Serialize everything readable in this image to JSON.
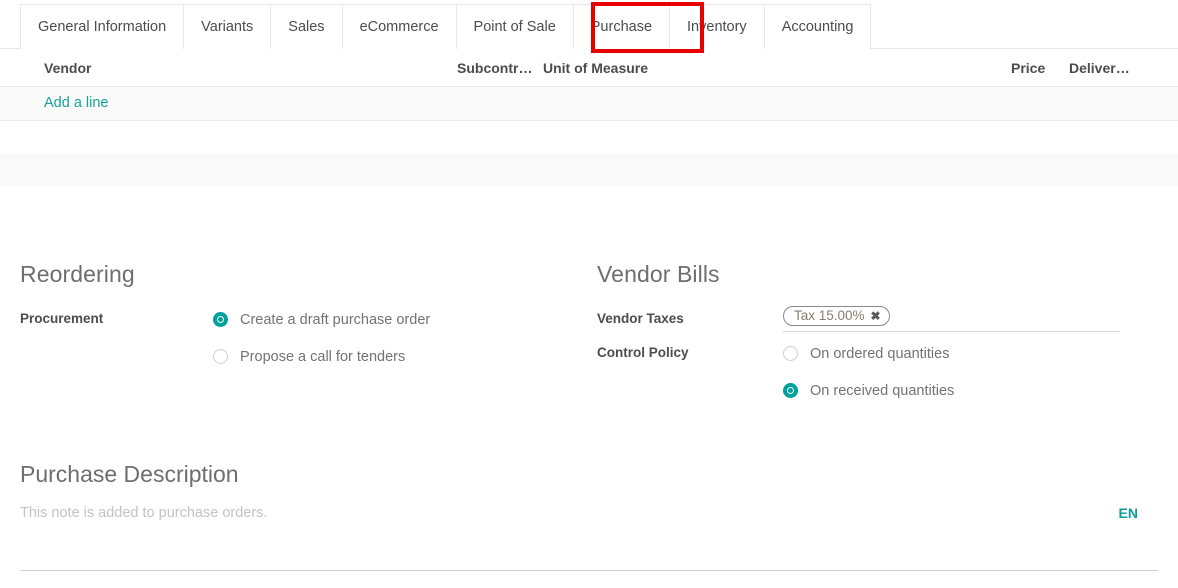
{
  "tabs": [
    {
      "label": "General Information",
      "active": false
    },
    {
      "label": "Variants",
      "active": false
    },
    {
      "label": "Sales",
      "active": false
    },
    {
      "label": "eCommerce",
      "active": false
    },
    {
      "label": "Point of Sale",
      "active": false
    },
    {
      "label": "Purchase",
      "active": true
    },
    {
      "label": "Inventory",
      "active": false
    },
    {
      "label": "Accounting",
      "active": false
    }
  ],
  "highlight": {
    "target_tab": "Purchase",
    "color": "#e60000"
  },
  "vendor_list": {
    "columns": [
      "Vendor",
      "Subcontr…",
      "Unit of Measure",
      "Price",
      "Deliver…"
    ],
    "rows": [],
    "add_line_label": "Add a line"
  },
  "reordering": {
    "title": "Reordering",
    "procurement": {
      "label": "Procurement",
      "options": [
        {
          "label": "Create a draft purchase order",
          "selected": true
        },
        {
          "label": "Propose a call for tenders",
          "selected": false
        }
      ]
    }
  },
  "vendor_bills": {
    "title": "Vendor Bills",
    "vendor_taxes": {
      "label": "Vendor Taxes",
      "tags": [
        "Tax 15.00%"
      ],
      "remove_glyph": "✖"
    },
    "control_policy": {
      "label": "Control Policy",
      "options": [
        {
          "label": "On ordered quantities",
          "selected": false
        },
        {
          "label": "On received quantities",
          "selected": true
        }
      ]
    }
  },
  "purchase_description": {
    "title": "Purchase Description",
    "placeholder": "This note is added to purchase orders.",
    "value": "",
    "language_badge": "EN"
  },
  "colors": {
    "accent_teal": "#00a09d",
    "link_teal": "#17a2a2",
    "highlight_red": "#e60000",
    "heading_gray": "#6e6e6e",
    "row_gray": "#fafafa"
  }
}
